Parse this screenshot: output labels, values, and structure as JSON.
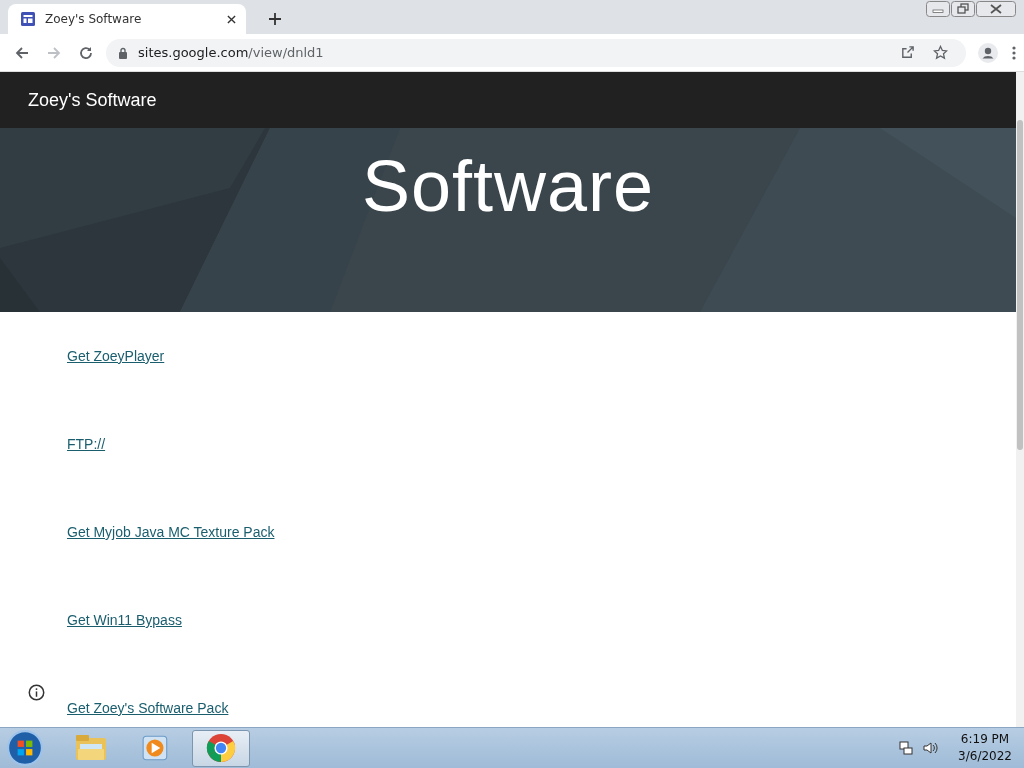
{
  "tabs": [
    {
      "title": "Zoey's Software",
      "selected": true
    }
  ],
  "address_bar": {
    "host": "sites.google.com",
    "path": "/view/dnld1"
  },
  "site_header": {
    "title": "Zoey's Software"
  },
  "hero": {
    "kind": "picture",
    "title": "Software"
  },
  "links": [
    {
      "label": "Get ZoeyPlayer"
    },
    {
      "label": "FTP://"
    },
    {
      "label": "Get Myjob Java MC Texture Pack"
    },
    {
      "label": "Get Win11 Bypass"
    },
    {
      "label": "Get Zoey's Software Pack"
    }
  ],
  "taskbar": {
    "apps": [
      {
        "kind": "explorer",
        "active": false
      },
      {
        "kind": "media",
        "active": false
      },
      {
        "kind": "chrome",
        "active": true
      }
    ],
    "time": "6:19 PM",
    "date": "3/6/2022"
  }
}
